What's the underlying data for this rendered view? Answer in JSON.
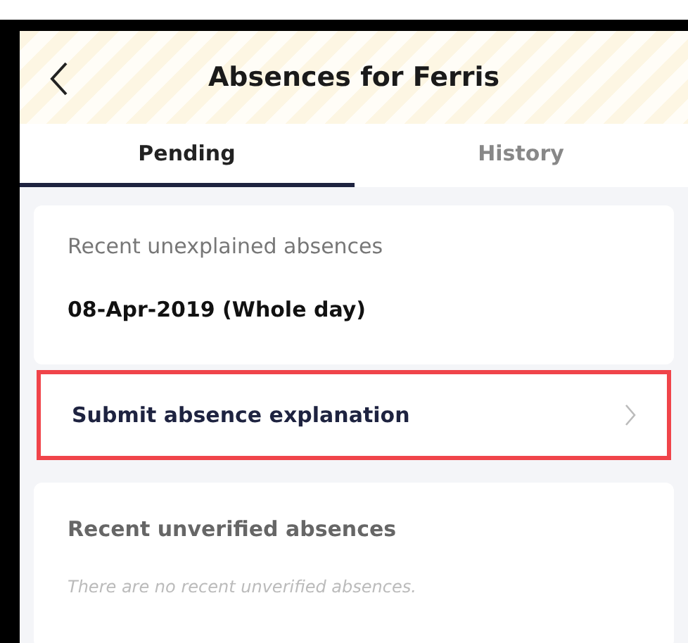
{
  "header": {
    "title": "Absences for Ferris"
  },
  "tabs": [
    {
      "label": "Pending",
      "selected": true
    },
    {
      "label": "History",
      "selected": false
    }
  ],
  "unexplained": {
    "heading": "Recent unexplained absences",
    "items": [
      "08-Apr-2019 (Whole day)"
    ],
    "action": {
      "label": "Submit absence explanation",
      "highlighted": true
    }
  },
  "unverified": {
    "heading": "Recent unverified absences",
    "empty_message": "There are no recent unverified absences."
  }
}
